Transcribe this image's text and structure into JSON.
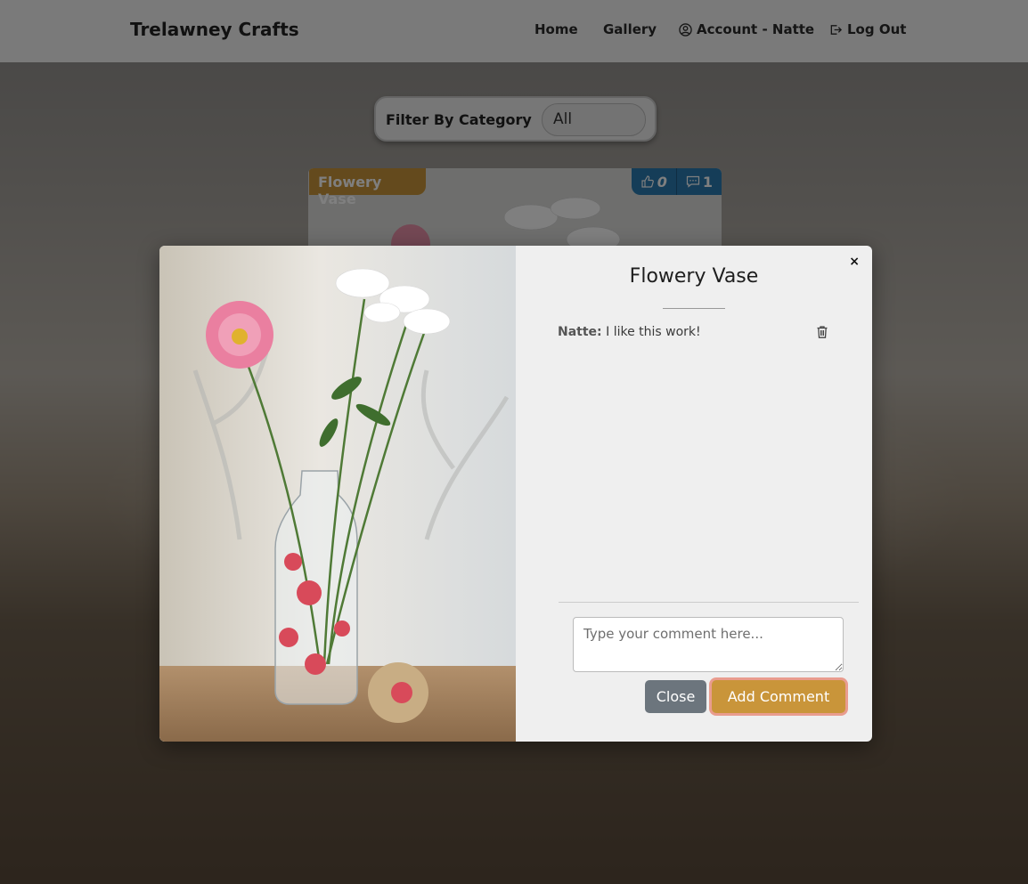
{
  "navbar": {
    "brand": "Trelawney Crafts",
    "links": {
      "home": "Home",
      "gallery": "Gallery",
      "account": "Account - Natte",
      "logout": "Log Out"
    }
  },
  "filter": {
    "label": "Filter By Category",
    "selected": "All"
  },
  "card": {
    "title": "Flowery Vase",
    "likes": "0",
    "comments": "1"
  },
  "modal": {
    "title": "Flowery Vase",
    "close_x": "×",
    "comments": [
      {
        "author": "Natte:",
        "text": "I like this work!"
      }
    ],
    "input_placeholder": "Type your comment here...",
    "close_label": "Close",
    "add_label": "Add Comment"
  },
  "colors": {
    "accent_gold": "#c9953a",
    "stats_blue": "#2a7ab0",
    "secondary_gray": "#6c757d"
  },
  "icons": {
    "account": "user-circle-icon",
    "logout": "sign-out-icon",
    "likes": "thumbs-up-icon",
    "comments": "comment-icon",
    "delete": "trash-icon"
  }
}
